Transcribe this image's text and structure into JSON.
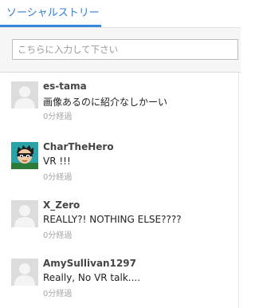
{
  "header": {
    "tab_label": "ソーシャルストリーム"
  },
  "search": {
    "placeholder": "こちらに入力して下さい"
  },
  "posts": [
    {
      "username": "es-tama",
      "message": "画像あるのに紹介なしかーい",
      "time": "0分経過",
      "avatar": "default-avatar"
    },
    {
      "username": "CharTheHero",
      "message": "VR !!!",
      "time": "0分経過",
      "avatar": "character-avatar"
    },
    {
      "username": "X_Zero",
      "message": "REALLY?! NOTHING ELSE????",
      "time": "0分経過",
      "avatar": "default-avatar"
    },
    {
      "username": "AmySullivan1297",
      "message": "Really, No VR talk....",
      "time": "0分経過",
      "avatar": "default-avatar"
    }
  ]
}
